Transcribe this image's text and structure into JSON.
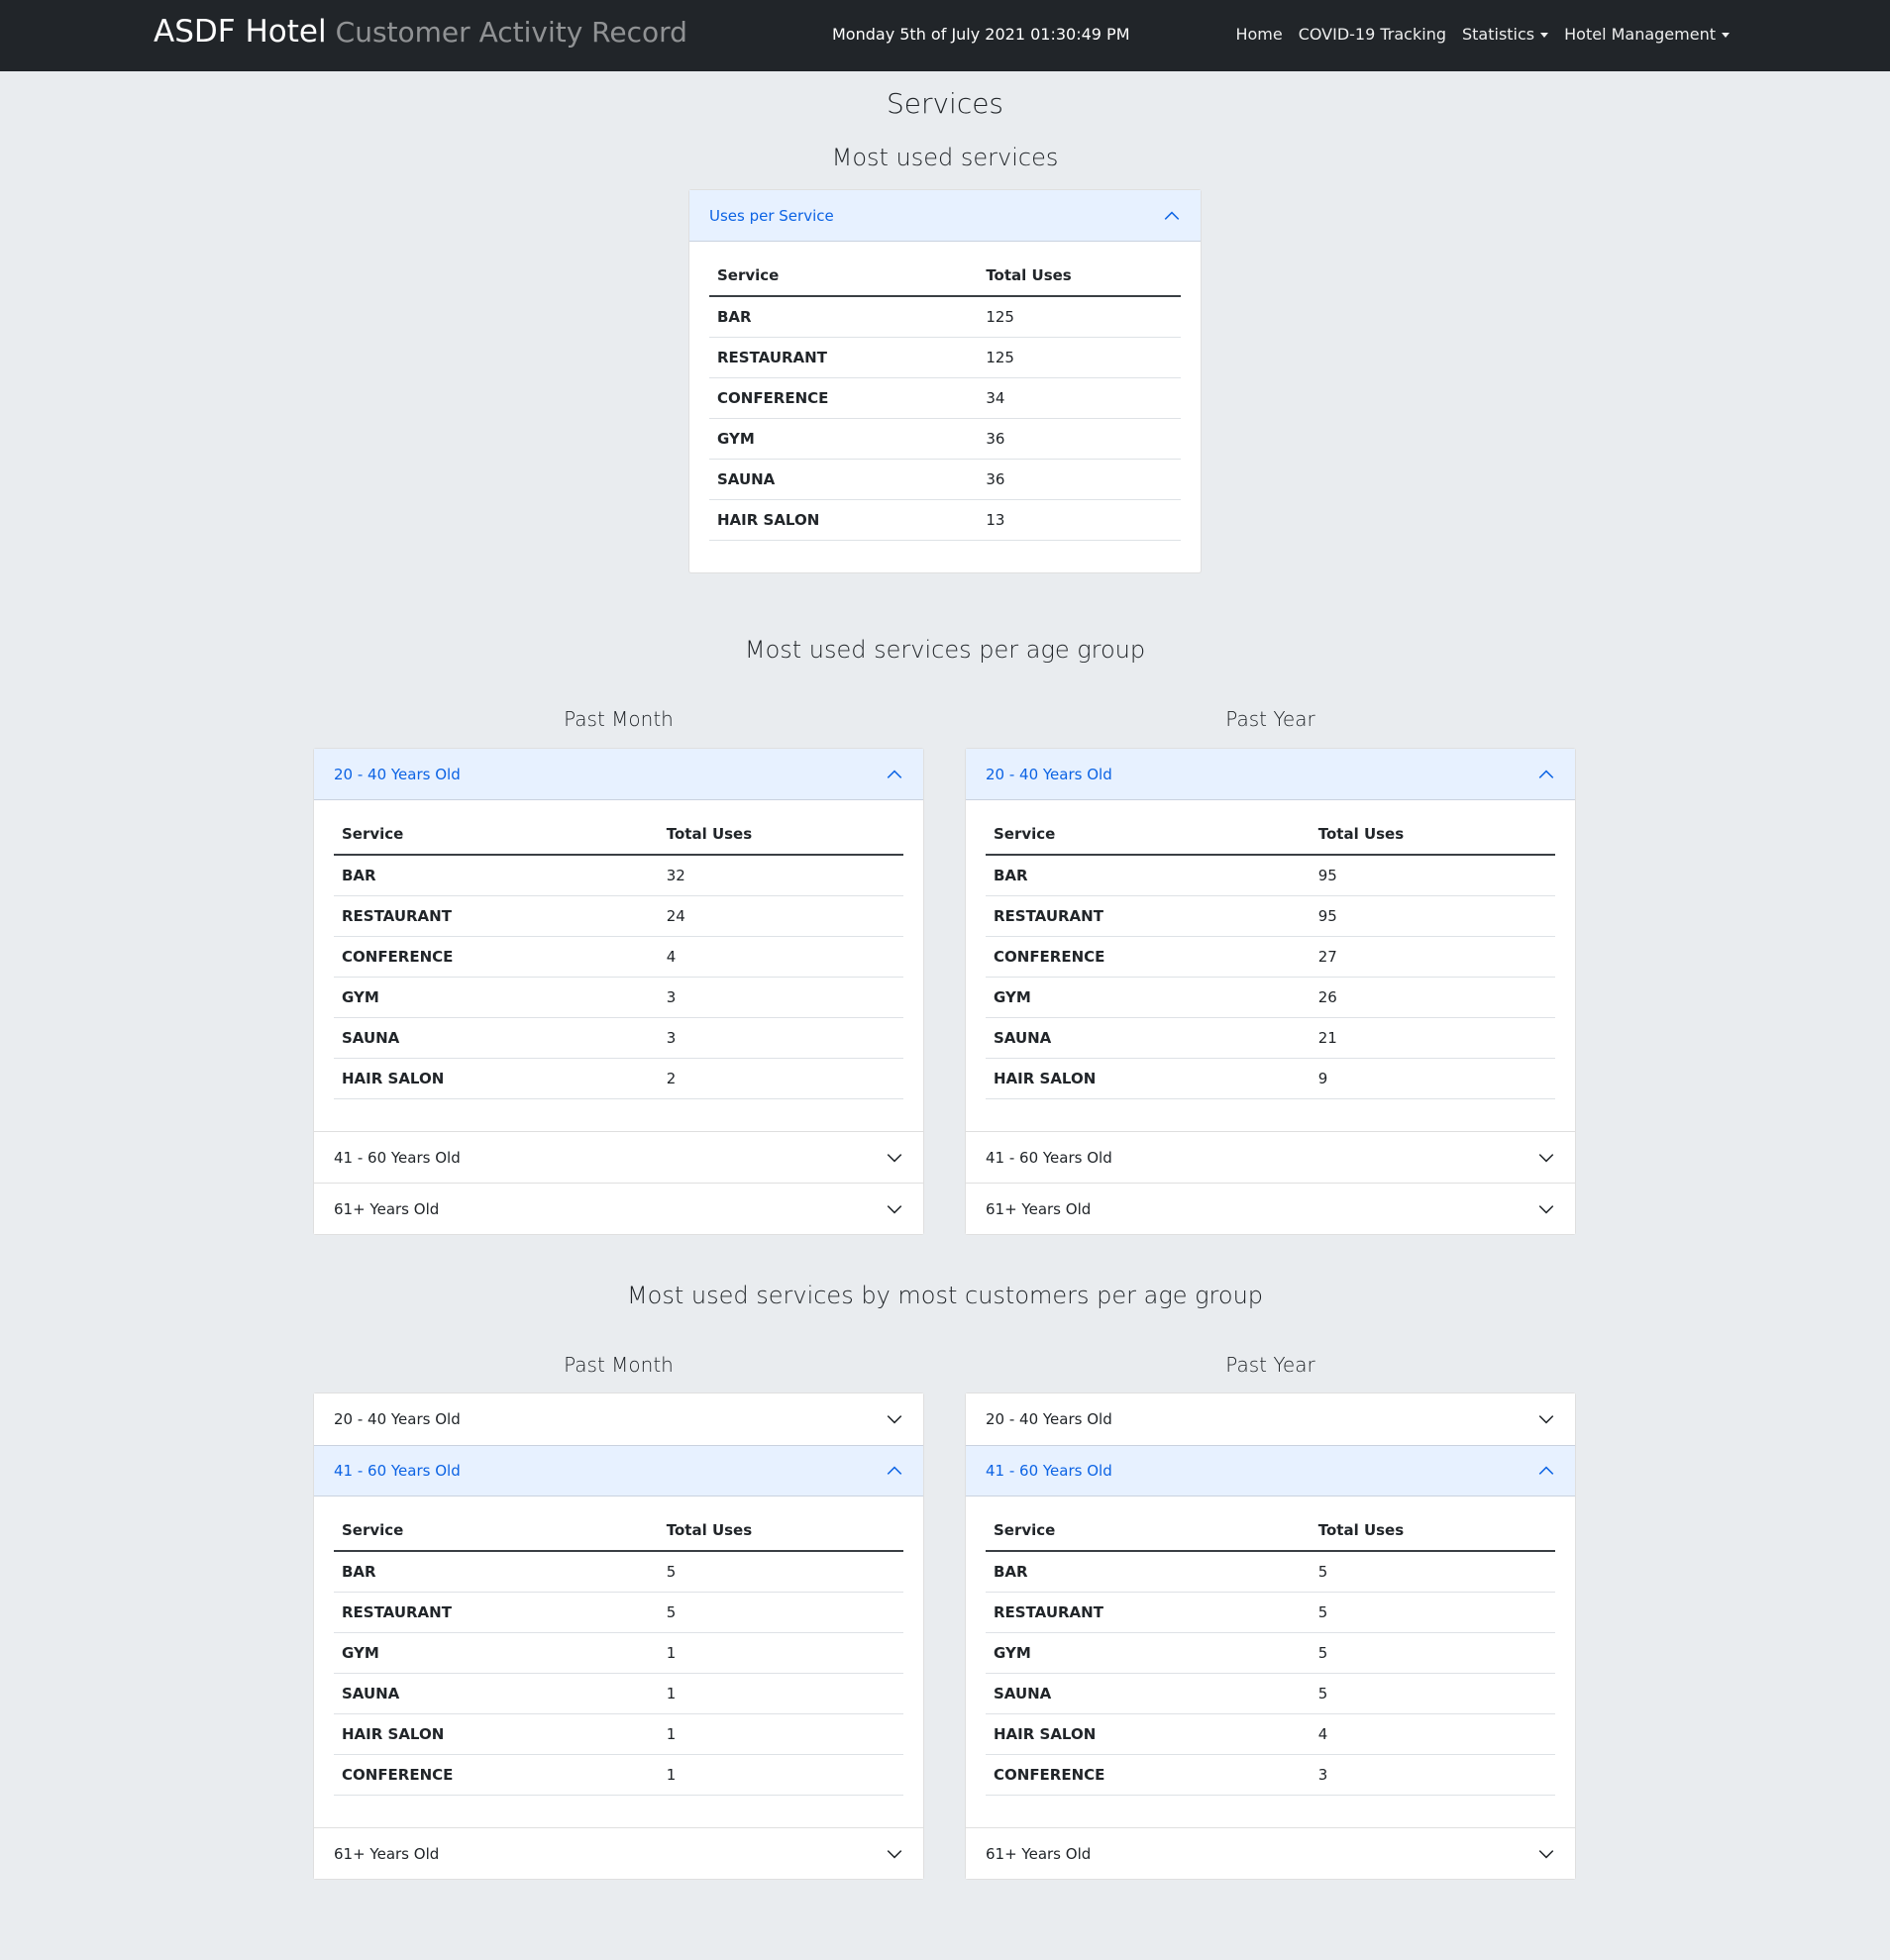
{
  "navbar": {
    "brand_name": "ASDF Hotel",
    "brand_sub": "Customer Activity Record",
    "datetime": "Monday 5th of July 2021 01:30:49 PM",
    "links": [
      "Home",
      "COVID-19 Tracking"
    ],
    "dropdowns": [
      "Statistics",
      "Hotel Management"
    ]
  },
  "page_title": "Services",
  "sections": {
    "most_used": "Most used services",
    "per_age": "Most used services per age group",
    "by_customers": "Most used services by most customers per age group"
  },
  "columns": {
    "month": "Past Month",
    "year": "Past Year"
  },
  "table_headers": {
    "service": "Service",
    "uses": "Total Uses"
  },
  "age_groups": [
    "20 - 40 Years Old",
    "41 - 60 Years Old",
    "61+ Years Old"
  ],
  "uses_per_service": {
    "header": "Uses per Service",
    "rows": [
      {
        "service": "BAR",
        "uses": "125"
      },
      {
        "service": "RESTAURANT",
        "uses": "125"
      },
      {
        "service": "CONFERENCE",
        "uses": "34"
      },
      {
        "service": "GYM",
        "uses": "36"
      },
      {
        "service": "SAUNA",
        "uses": "36"
      },
      {
        "service": "HAIR SALON",
        "uses": "13"
      }
    ]
  },
  "age_month_20_40": [
    {
      "service": "BAR",
      "uses": "32"
    },
    {
      "service": "RESTAURANT",
      "uses": "24"
    },
    {
      "service": "CONFERENCE",
      "uses": "4"
    },
    {
      "service": "GYM",
      "uses": "3"
    },
    {
      "service": "SAUNA",
      "uses": "3"
    },
    {
      "service": "HAIR SALON",
      "uses": "2"
    }
  ],
  "age_year_20_40": [
    {
      "service": "BAR",
      "uses": "95"
    },
    {
      "service": "RESTAURANT",
      "uses": "95"
    },
    {
      "service": "CONFERENCE",
      "uses": "27"
    },
    {
      "service": "GYM",
      "uses": "26"
    },
    {
      "service": "SAUNA",
      "uses": "21"
    },
    {
      "service": "HAIR SALON",
      "uses": "9"
    }
  ],
  "cust_month_41_60": [
    {
      "service": "BAR",
      "uses": "5"
    },
    {
      "service": "RESTAURANT",
      "uses": "5"
    },
    {
      "service": "GYM",
      "uses": "1"
    },
    {
      "service": "SAUNA",
      "uses": "1"
    },
    {
      "service": "HAIR SALON",
      "uses": "1"
    },
    {
      "service": "CONFERENCE",
      "uses": "1"
    }
  ],
  "cust_year_41_60": [
    {
      "service": "BAR",
      "uses": "5"
    },
    {
      "service": "RESTAURANT",
      "uses": "5"
    },
    {
      "service": "GYM",
      "uses": "5"
    },
    {
      "service": "SAUNA",
      "uses": "5"
    },
    {
      "service": "HAIR SALON",
      "uses": "4"
    },
    {
      "service": "CONFERENCE",
      "uses": "3"
    }
  ]
}
